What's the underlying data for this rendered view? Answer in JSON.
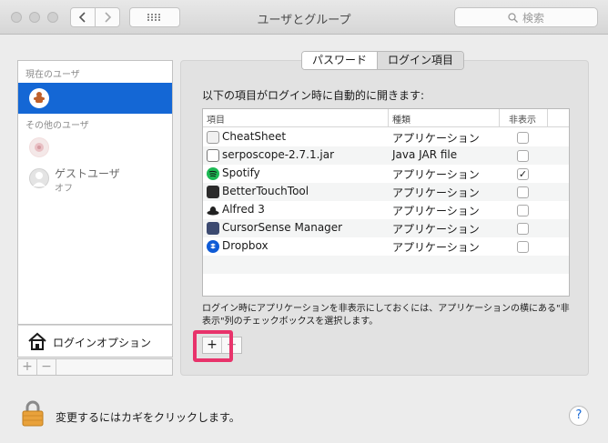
{
  "window": {
    "title": "ユーザとグループ"
  },
  "toolbar": {
    "search_placeholder": "検索"
  },
  "sidebar": {
    "current_users_header": "現在のユーザ",
    "other_users_header": "その他のユーザ",
    "guest_name": "ゲストユーザ",
    "guest_status": "オフ",
    "login_options_label": "ログインオプション",
    "add_label": "+",
    "remove_label": "−"
  },
  "tabs": [
    {
      "label": "パスワード",
      "active": false
    },
    {
      "label": "ログイン項目",
      "active": true
    }
  ],
  "login_items": {
    "heading": "以下の項目がログイン時に自動的に開きます:",
    "columns": {
      "item": "項目",
      "kind": "種類",
      "hide": "非表示"
    },
    "rows": [
      {
        "name": "CheatSheet",
        "kind": "アプリケーション",
        "hidden": false,
        "icon": "cheatsheet-icon"
      },
      {
        "name": "serposcope-2.7.1.jar",
        "kind": "Java JAR file",
        "hidden": false,
        "icon": "jar-file-icon"
      },
      {
        "name": "Spotify",
        "kind": "アプリケーション",
        "hidden": true,
        "icon": "spotify-icon"
      },
      {
        "name": "BetterTouchTool",
        "kind": "アプリケーション",
        "hidden": false,
        "icon": "bettertouchtool-icon"
      },
      {
        "name": "Alfred 3",
        "kind": "アプリケーション",
        "hidden": false,
        "icon": "alfred-icon"
      },
      {
        "name": "CursorSense Manager",
        "kind": "アプリケーション",
        "hidden": false,
        "icon": "cursorsense-icon"
      },
      {
        "name": "Dropbox",
        "kind": "アプリケーション",
        "hidden": false,
        "icon": "dropbox-icon"
      }
    ],
    "hint": "ログイン時にアプリケーションを非表示にしておくには、アプリケーションの横にある\"非表示\"列のチェックボックスを選択します。",
    "add_label": "+",
    "remove_label": "−"
  },
  "footer": {
    "lock_text": "変更するにはカギをクリックします。",
    "help_label": "?"
  },
  "colors": {
    "selection": "#1467d5",
    "highlight": "#e8336b",
    "spotify": "#1db954",
    "dropbox": "#0f5bd6"
  }
}
